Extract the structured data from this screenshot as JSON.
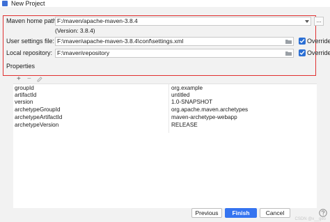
{
  "window": {
    "title": "New Project"
  },
  "maven": {
    "home_label": "Maven home path:",
    "home_value": "F:/maven/apache-maven-3.8.4",
    "home_browse": "...",
    "version_text": "(Version: 3.8.4)",
    "settings_label": "User settings file:",
    "settings_value": "F:\\maven\\apache-maven-3.8.4\\conf\\settings.xml",
    "settings_override": "Override",
    "repo_label": "Local repository:",
    "repo_value": "F:\\maven\\repository",
    "repo_override": "Override"
  },
  "properties": {
    "label": "Properties",
    "toolbar": {
      "add": "+",
      "remove": "−"
    },
    "rows": [
      {
        "key": "groupId",
        "value": "org.example"
      },
      {
        "key": "artifactId",
        "value": "untitled"
      },
      {
        "key": "version",
        "value": "1.0-SNAPSHOT"
      },
      {
        "key": "archetypeGroupId",
        "value": "org.apache.maven.archetypes"
      },
      {
        "key": "archetypeArtifactId",
        "value": "maven-archetype-webapp"
      },
      {
        "key": "archetypeVersion",
        "value": "RELEASE"
      }
    ]
  },
  "footer": {
    "previous": "Previous",
    "finish": "Finish",
    "cancel": "Cancel",
    "watermark": "CSDN @x__geo"
  },
  "colors": {
    "accent": "#3574f0",
    "highlight_box": "#e03131"
  }
}
